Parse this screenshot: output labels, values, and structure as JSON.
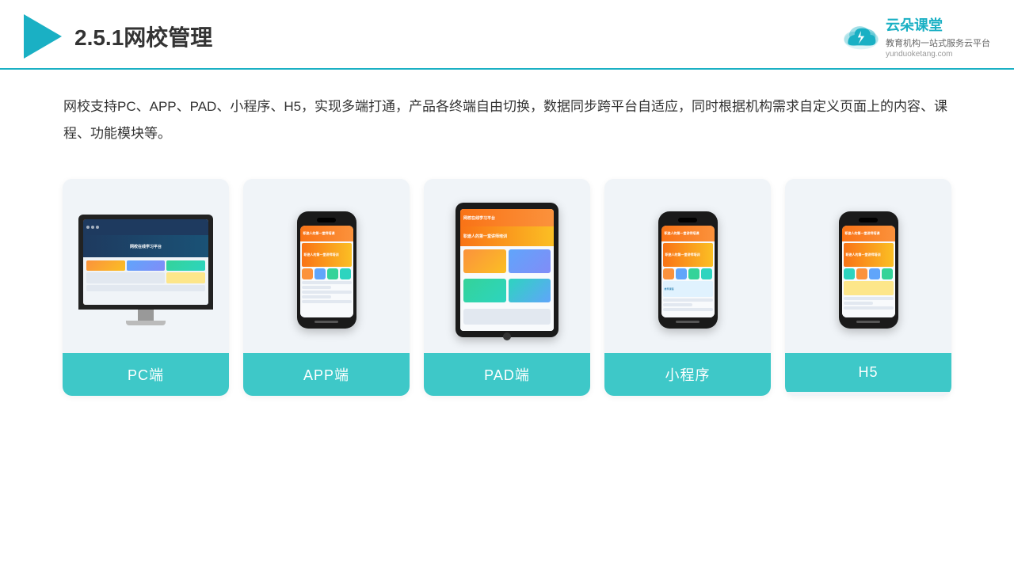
{
  "header": {
    "title": "2.5.1网校管理",
    "logo_name": "云朵课堂",
    "logo_url": "yunduoketang.com",
    "logo_tagline": "教育机构一站\n式服务云平台"
  },
  "description": {
    "text": "网校支持PC、APP、PAD、小程序、H5，实现多端打通，产品各终端自由切换，数据同步跨平台自适应，同时根据机构需求自定义页面上的内容、课程、功能模块等。"
  },
  "cards": [
    {
      "id": "pc",
      "label": "PC端",
      "device": "monitor"
    },
    {
      "id": "app",
      "label": "APP端",
      "device": "phone"
    },
    {
      "id": "pad",
      "label": "PAD端",
      "device": "tablet"
    },
    {
      "id": "miniapp",
      "label": "小程序",
      "device": "phone"
    },
    {
      "id": "h5",
      "label": "H5",
      "device": "phone"
    }
  ],
  "colors": {
    "teal": "#3ec8c8",
    "accent": "#1ab0c4",
    "dark": "#1a1a1a",
    "bg_card": "#f0f4f8"
  }
}
